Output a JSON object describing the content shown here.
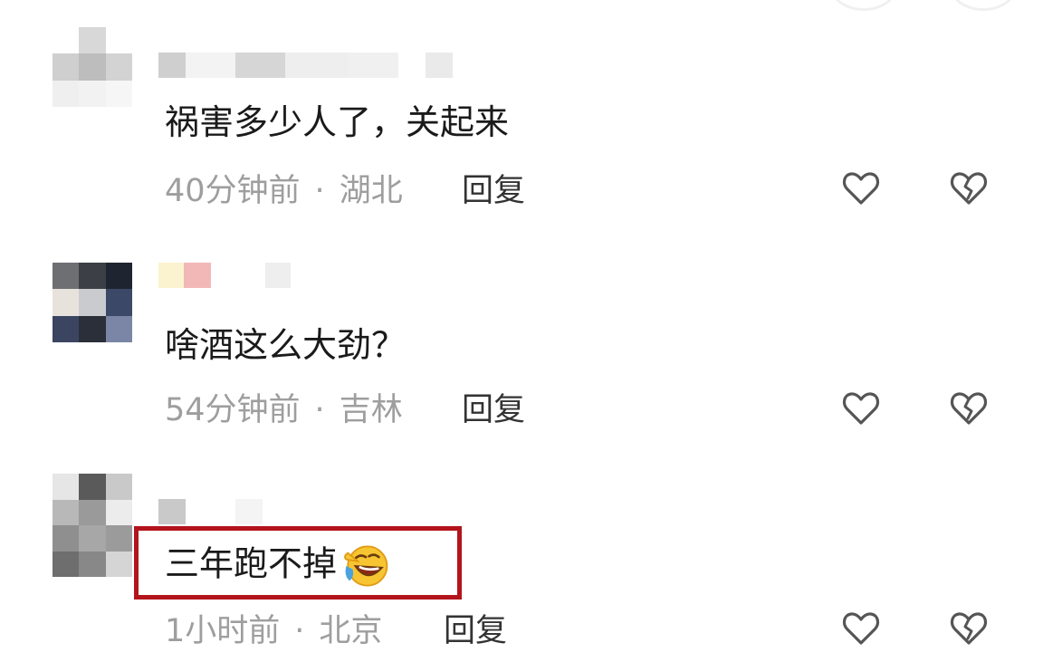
{
  "comments": [
    {
      "text": "祸害多少人了，关起来",
      "time": "40分钟前",
      "location": "湖北",
      "reply": "回复"
    },
    {
      "text": "啥酒这么大劲？",
      "time": "54分钟前",
      "location": "吉林",
      "reply": "回复"
    },
    {
      "text": "三年跑不掉",
      "time": "1小时前",
      "location": "北京",
      "reply": "回复"
    }
  ],
  "separator": "·",
  "icons": {
    "like": "heart-outline-icon",
    "dislike": "broken-heart-icon",
    "emoji": "laughing-crying-emoji"
  },
  "colors": {
    "meta_text": "#9e9e9e",
    "highlight_border": "#b3141c",
    "icon_stroke": "#555555"
  }
}
